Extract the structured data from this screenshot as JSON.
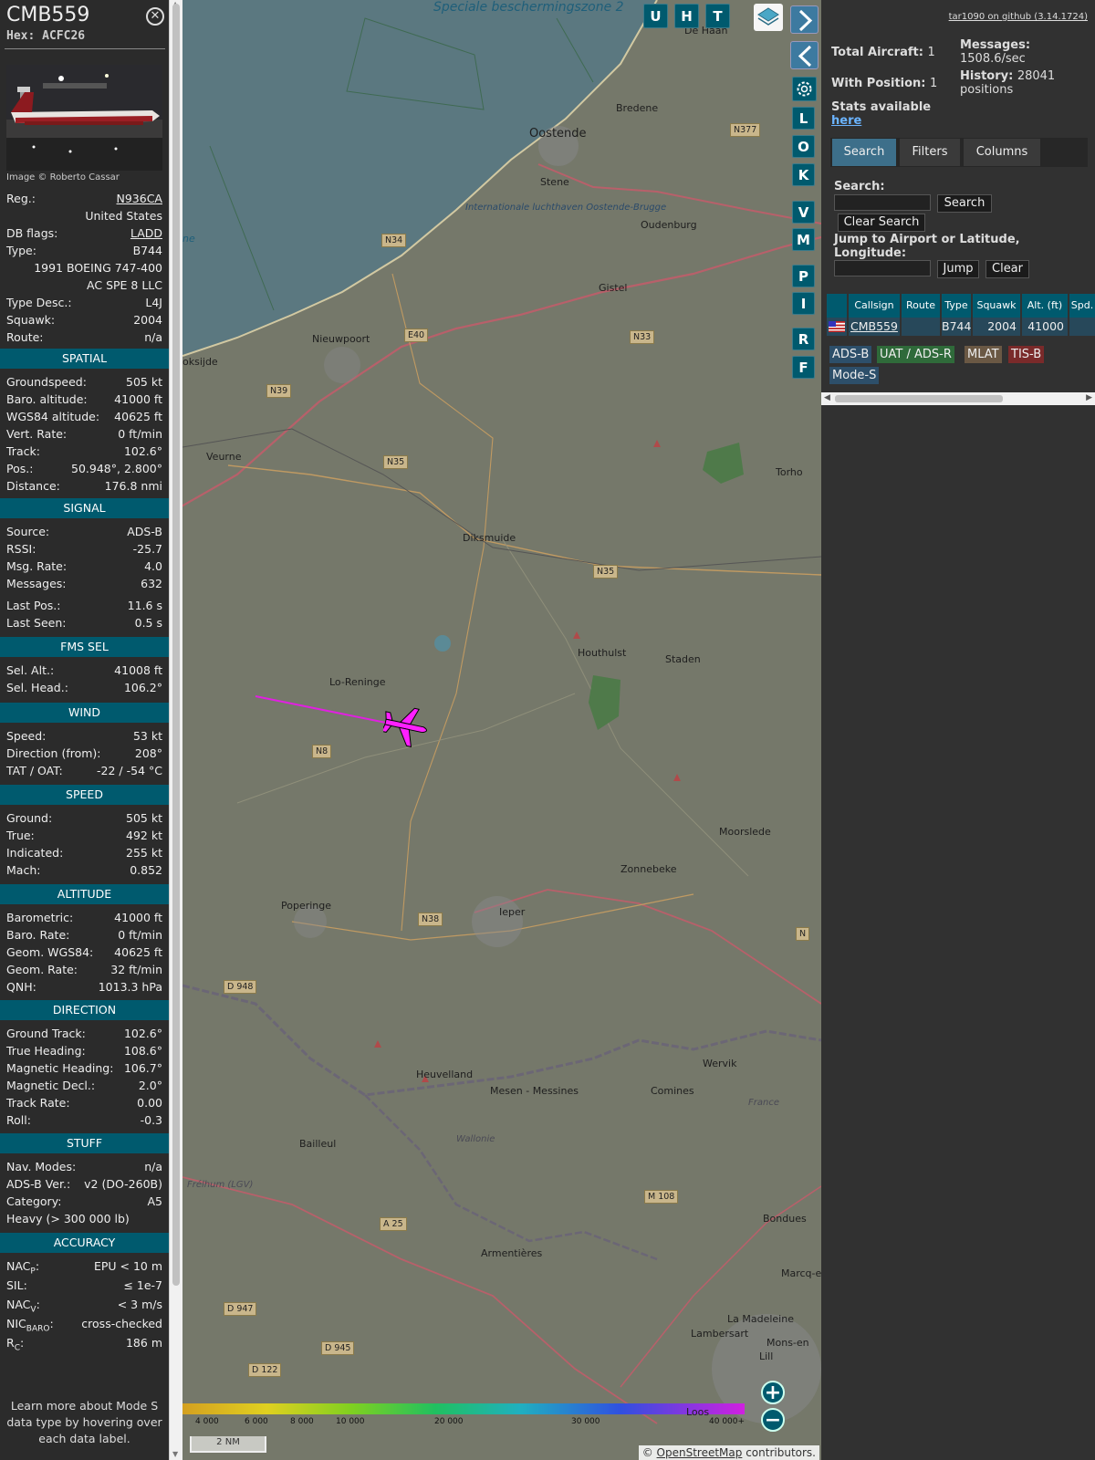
{
  "aircraft": {
    "callsign": "CMB559",
    "hex_line": "Hex: ACFC26",
    "photo_credit": "Image © Roberto Cassar"
  },
  "info": [
    {
      "label": "Reg.:",
      "value": "N936CA",
      "link": true
    },
    {
      "label": "",
      "value": "United States"
    },
    {
      "label": "DB flags:",
      "value": "LADD",
      "link": true
    },
    {
      "label": "Type:",
      "value": "B744"
    },
    {
      "label": "",
      "value": "1991 BOEING 747-400"
    },
    {
      "label": "",
      "value": "AC SPE 8 LLC"
    },
    {
      "label": "Type Desc.:",
      "value": "L4J"
    },
    {
      "label": "Squawk:",
      "value": "2004"
    },
    {
      "label": "Route:",
      "value": "n/a"
    }
  ],
  "sections": {
    "spatial": {
      "title": "SPATIAL",
      "rows": [
        {
          "label": "Groundspeed:",
          "value": "505 kt"
        },
        {
          "label": "Baro. altitude:",
          "value": "41000 ft"
        },
        {
          "label": "WGS84 altitude:",
          "value": "40625 ft"
        },
        {
          "label": "Vert. Rate:",
          "value": "0 ft/min"
        },
        {
          "label": "Track:",
          "value": "102.6°"
        },
        {
          "label": "Pos.:",
          "value": "50.948°, 2.800°"
        },
        {
          "label": "Distance:",
          "value": "176.8 nmi"
        }
      ]
    },
    "signal": {
      "title": "SIGNAL",
      "rows": [
        {
          "label": "Source:",
          "value": "ADS-B"
        },
        {
          "label": "RSSI:",
          "value": "-25.7"
        },
        {
          "label": "Msg. Rate:",
          "value": "4.0"
        },
        {
          "label": "Messages:",
          "value": "632"
        },
        {
          "label": "Last Pos.:",
          "value": "11.6 s"
        },
        {
          "label": "Last Seen:",
          "value": "0.5 s"
        }
      ]
    },
    "fms": {
      "title": "FMS SEL",
      "rows": [
        {
          "label": "Sel. Alt.:",
          "value": "41008 ft"
        },
        {
          "label": "Sel. Head.:",
          "value": "106.2°"
        }
      ]
    },
    "wind": {
      "title": "WIND",
      "rows": [
        {
          "label": "Speed:",
          "value": "53 kt"
        },
        {
          "label": "Direction (from):",
          "value": "208°"
        },
        {
          "label": "TAT / OAT:",
          "value": "-22 / -54 °C"
        }
      ]
    },
    "speed": {
      "title": "SPEED",
      "rows": [
        {
          "label": "Ground:",
          "value": "505 kt"
        },
        {
          "label": "True:",
          "value": "492 kt"
        },
        {
          "label": "Indicated:",
          "value": "255 kt"
        },
        {
          "label": "Mach:",
          "value": "0.852"
        }
      ]
    },
    "altitude": {
      "title": "ALTITUDE",
      "rows": [
        {
          "label": "Barometric:",
          "value": "41000 ft"
        },
        {
          "label": "Baro. Rate:",
          "value": "0 ft/min"
        },
        {
          "label": "Geom. WGS84:",
          "value": "40625 ft"
        },
        {
          "label": "Geom. Rate:",
          "value": "32 ft/min"
        },
        {
          "label": "QNH:",
          "value": "1013.3 hPa"
        }
      ]
    },
    "direction": {
      "title": "DIRECTION",
      "rows": [
        {
          "label": "Ground Track:",
          "value": "102.6°"
        },
        {
          "label": "True Heading:",
          "value": "108.6°"
        },
        {
          "label": "Magnetic Heading:",
          "value": "106.7°"
        },
        {
          "label": "Magnetic Decl.:",
          "value": "2.0°"
        },
        {
          "label": "Track Rate:",
          "value": "0.00"
        },
        {
          "label": "Roll:",
          "value": "-0.3"
        }
      ]
    },
    "stuff": {
      "title": "STUFF",
      "rows": [
        {
          "label": "Nav. Modes:",
          "value": "n/a"
        },
        {
          "label": "ADS-B Ver.:",
          "value": "v2 (DO-260B)"
        },
        {
          "label": "Category:",
          "value": "A5"
        },
        {
          "label": "Heavy (> 300 000 lb)",
          "value": ""
        }
      ]
    },
    "accuracy": {
      "title": "ACCURACY",
      "rows": [
        {
          "label": "NAC",
          "sub": "P",
          "suffix": ":",
          "value": "EPU < 10 m"
        },
        {
          "label": "SIL:",
          "value": "≤ 1e-7"
        },
        {
          "label": "NAC",
          "sub": "V",
          "suffix": ":",
          "value": "< 3 m/s"
        },
        {
          "label": "NIC",
          "sub": "BARO",
          "suffix": ":",
          "value": "cross-checked"
        },
        {
          "label": "R",
          "sub": "C",
          "suffix": ":",
          "value": "186 m"
        }
      ]
    }
  },
  "learn_more": "Learn more about Mode S data type by hovering over each data label.",
  "map": {
    "toolbar_letters": [
      "U",
      "H",
      "T"
    ],
    "side_letters": [
      "L",
      "O",
      "K",
      "V",
      "M",
      "P",
      "I",
      "R",
      "F"
    ],
    "labels": {
      "zone": "Speciale beschermingszone 2",
      "airport": "Internationale luchthaven Oostende-Brugge",
      "ne": "ne"
    },
    "places": [
      "De Haan",
      "Bredene",
      "Oostende",
      "Stene",
      "Oudenburg",
      "Gistel",
      "Nieuwpoort",
      "oksijde",
      "Veurne",
      "Diksmuide",
      "Torho",
      "Houthulst",
      "Staden",
      "Lo-Reninge",
      "Moorslede",
      "Zonnebeke",
      "Poperinge",
      "Ieper",
      "Heuvelland",
      "Mesen - Messines",
      "Comines",
      "Wervik",
      "Bailleul",
      "Armentières",
      "Bondues",
      "Marcq-en-",
      "La Madeleine",
      "Lambersart",
      "Mons-en",
      "Lill",
      "Loos",
      "Wallonie",
      "France",
      "Frélhum (LGV)"
    ],
    "roads": [
      "N377",
      "N34",
      "E40",
      "N33",
      "N39",
      "N35",
      "N35",
      "N8",
      "N38",
      "D 948",
      "A 25",
      "M 108",
      "D 947",
      "D 945",
      "D 122",
      "N"
    ],
    "altitude_scale": [
      "4 000",
      "6 000",
      "8 000",
      "10 000",
      "20 000",
      "30 000",
      "40 000+"
    ],
    "scale_text": "2 NM",
    "attribution_prefix": "© ",
    "attribution_link": "OpenStreetMap",
    "attribution_suffix": " contributors.",
    "zoom_in": "+",
    "zoom_out": "−",
    "colors": {
      "track": "#e020e0",
      "aircraft": "#ff20ff",
      "land": "#75786a",
      "sea": "#5b7880",
      "button": "#005a6e"
    }
  },
  "panel": {
    "github_link": "tar1090 on github (3.14.1724)",
    "total_aircraft_label": "Total Aircraft:",
    "total_aircraft_value": "1",
    "with_position_label": "With Position:",
    "with_position_value": "1",
    "messages_label": "Messages:",
    "messages_value": "1508.6/sec",
    "history_label": "History:",
    "history_value": "28041",
    "history_unit": "positions",
    "stats_label": "Stats available",
    "stats_link": "here",
    "tabs": [
      "Search",
      "Filters",
      "Columns"
    ],
    "search_label": "Search:",
    "search_button": "Search",
    "clear_search_button": "Clear Search",
    "jump_label": "Jump to Airport or Latitude, Longitude:",
    "jump_button": "Jump",
    "clear_button": "Clear",
    "columns": [
      "Callsign",
      "Route",
      "Type",
      "Squawk",
      "Alt. (ft)",
      "Spd."
    ],
    "row": {
      "callsign": "CMB559",
      "route": "",
      "type": "B744",
      "squawk": "2004",
      "alt": "41000"
    },
    "sources": [
      "ADS-B",
      "UAT / ADS-R",
      "MLAT",
      "TIS-B",
      "Mode-S"
    ]
  }
}
